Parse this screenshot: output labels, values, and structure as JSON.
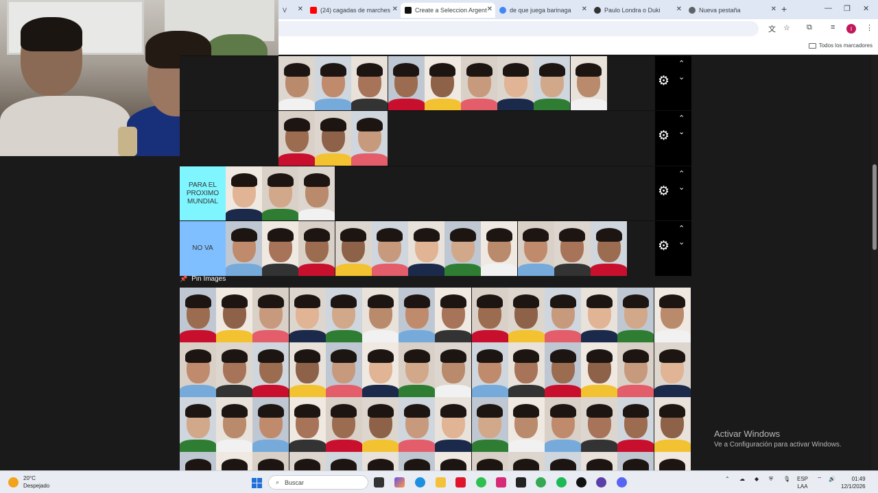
{
  "browser": {
    "tabs": [
      {
        "label": "(24) cagadas de marches",
        "favicon": "youtube-icon",
        "color": "#ff0000"
      },
      {
        "label": "Create a Seleccion Argent",
        "favicon": "tiermaker-icon",
        "color": "#111111",
        "active": true
      },
      {
        "label": "de que juega barinaga",
        "favicon": "google-icon",
        "color": "#4285f4"
      },
      {
        "label": "Paulo Londra o Duki",
        "favicon": "chatgpt-icon",
        "color": "#333333"
      },
      {
        "label": "Nueva pestaña",
        "favicon": "chrome-icon",
        "color": "#5f6368"
      }
    ],
    "partial_tab_text": "V",
    "bookmarks_all": "Todos los marcadores"
  },
  "tiers": [
    {
      "label": "",
      "color": "#1a1a1a",
      "player_count": 9
    },
    {
      "label": "",
      "color": "#1a1a1a",
      "player_count": 3
    },
    {
      "label": "PARA EL PROXIMO MUNDIAL",
      "color": "#7ff6ff",
      "player_count": 3
    },
    {
      "label": "NO VA",
      "color": "#80bfff",
      "player_count": 11
    }
  ],
  "pool": {
    "pin_label": "Pin Images",
    "rows": 4,
    "cols": 14
  },
  "watermark": {
    "title": "Activar Windows",
    "subtitle": "Ve a Configuración para activar Windows."
  },
  "taskbar": {
    "weather_temp": "20°C",
    "weather_desc": "Despejado",
    "search_placeholder": "Buscar",
    "lang_top": "ESP",
    "lang_bottom": "LAA",
    "time": "01:49",
    "date": "12/1/2026"
  }
}
